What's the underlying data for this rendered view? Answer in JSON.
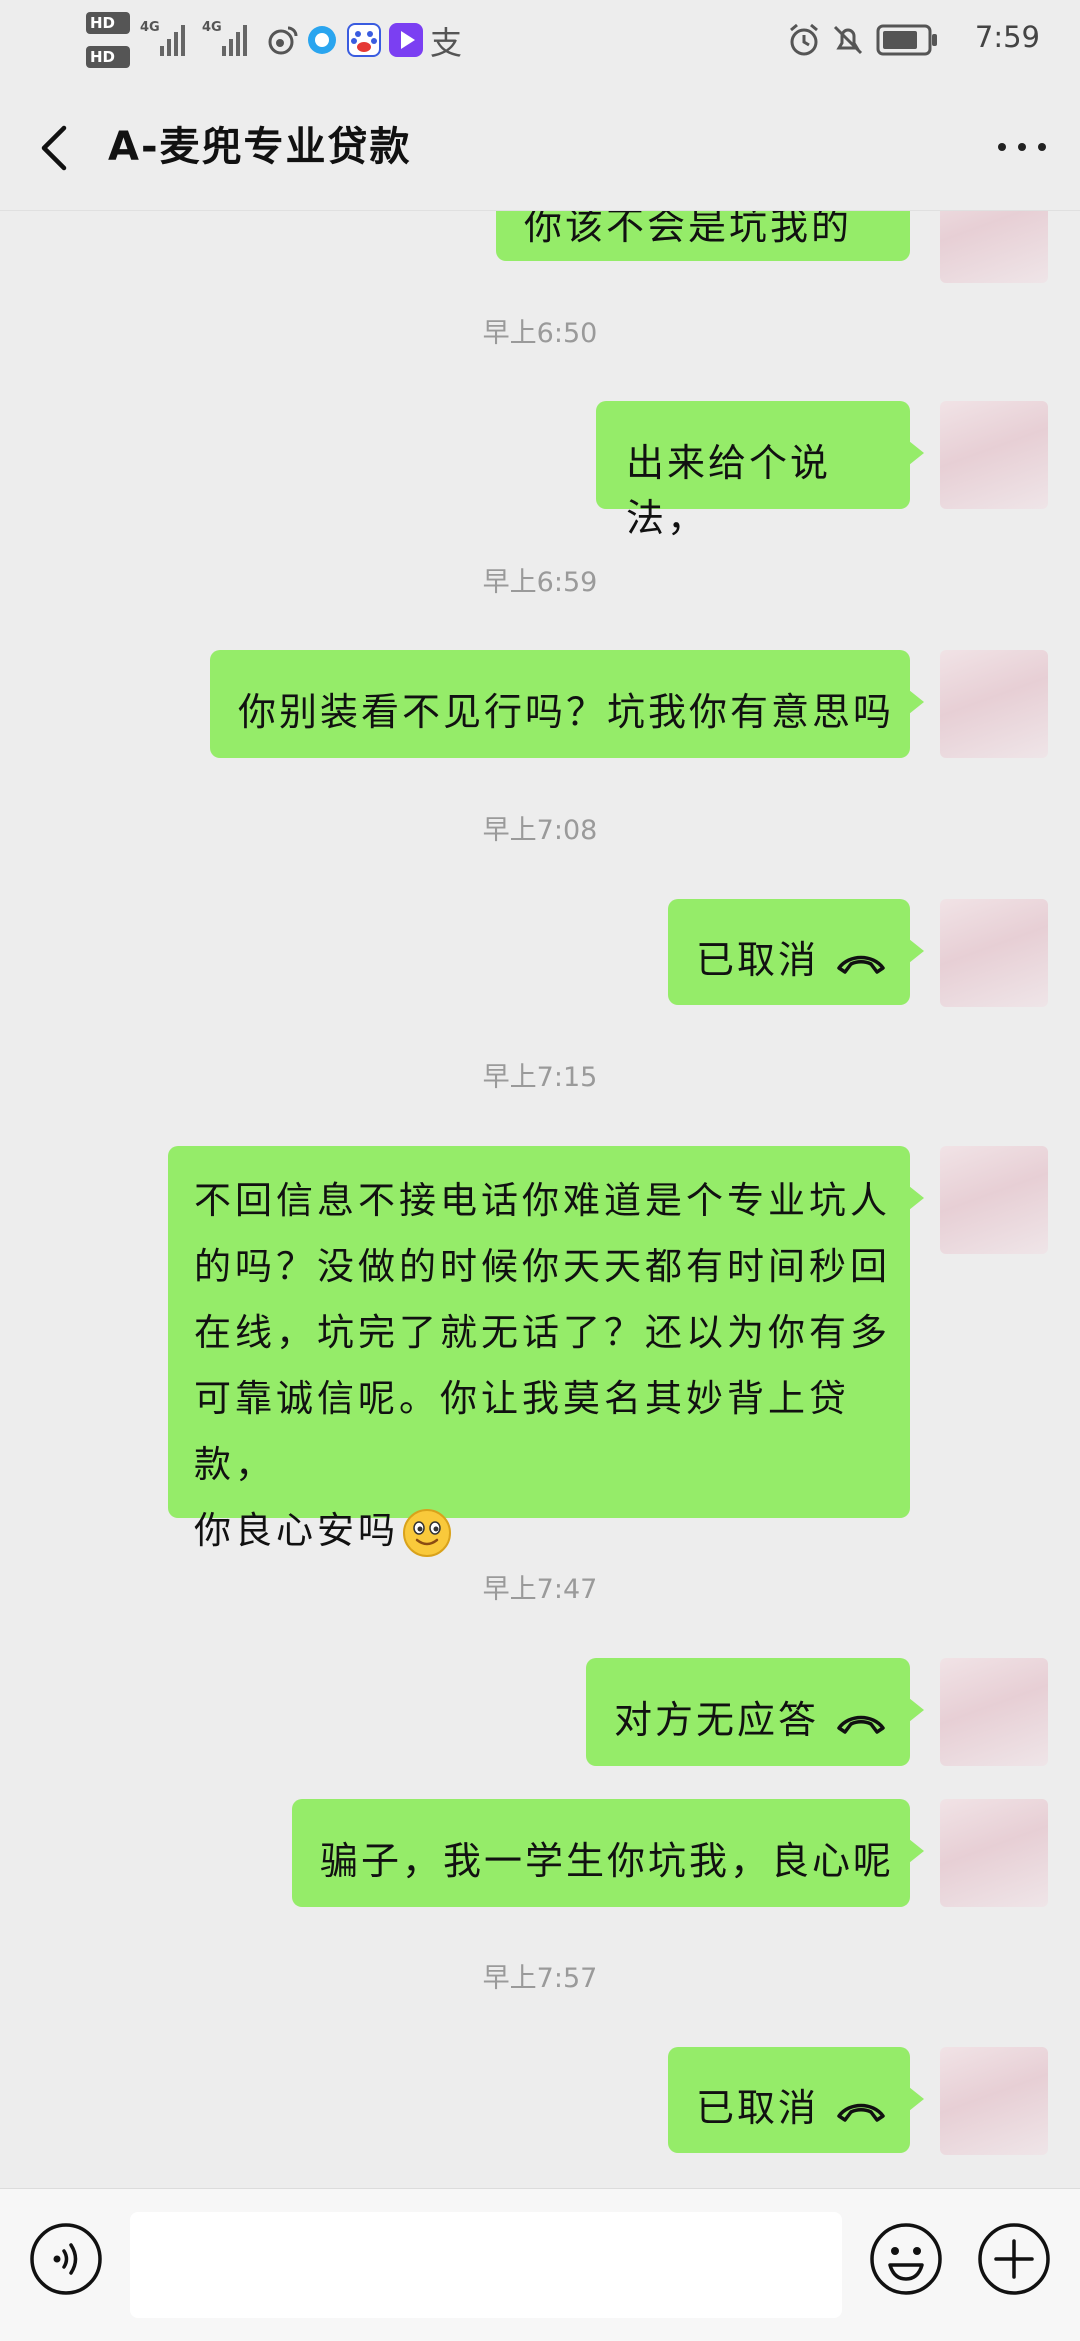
{
  "status_bar": {
    "hd1": "HD",
    "hd2": "HD",
    "sim1_label": "4G",
    "sim2_label": "4G",
    "alipay_glyph": "支",
    "time": "7:59",
    "icons": [
      "hd-icon",
      "signal-icon",
      "weibo-icon",
      "browser-icon",
      "baidu-icon",
      "video-app-icon",
      "alipay-icon",
      "alarm-icon",
      "mute-icon",
      "battery-icon"
    ]
  },
  "nav": {
    "title": "A-麦兜专业贷款",
    "back_icon": "chevron-left-icon",
    "more_icon": "more-dots-icon"
  },
  "messages": [
    {
      "type": "text",
      "text": "你该不会是坑我的吧",
      "partial": true
    },
    {
      "type": "time",
      "text": "早上6:50"
    },
    {
      "type": "text",
      "text": "出来给个说法，"
    },
    {
      "type": "time",
      "text": "早上6:59"
    },
    {
      "type": "text",
      "text": "你别装看不见行吗？坑我你有意思吗"
    },
    {
      "type": "time",
      "text": "早上7:08"
    },
    {
      "type": "call",
      "text": "已取消",
      "icon": "phone-hangup-icon"
    },
    {
      "type": "time",
      "text": "早上7:15"
    },
    {
      "type": "text_multiline",
      "lines": [
        "不回信息不接电话你难道是个专业坑人",
        "的吗？没做的时候你天天都有时间秒回",
        "在线，坑完了就无话了？还以为你有多",
        "可靠诚信呢。你让我莫名其妙背上贷款，",
        "你良心安吗"
      ],
      "emoji": "smile-emoji-icon"
    },
    {
      "type": "time",
      "text": "早上7:47"
    },
    {
      "type": "call",
      "text": "对方无应答",
      "icon": "phone-hangup-icon"
    },
    {
      "type": "text",
      "text": "骗子，我一学生你坑我，良心呢"
    },
    {
      "type": "time",
      "text": "早上7:57"
    },
    {
      "type": "call",
      "text": "已取消",
      "icon": "phone-hangup-icon"
    }
  ],
  "input_bar": {
    "value": "",
    "icons": [
      "voice-icon",
      "emoji-icon",
      "plus-icon"
    ]
  },
  "colors": {
    "background": "#ededed",
    "bubble": "#95ec69",
    "timestamp": "#9a9a9a",
    "input_bar": "#f7f7f7"
  }
}
